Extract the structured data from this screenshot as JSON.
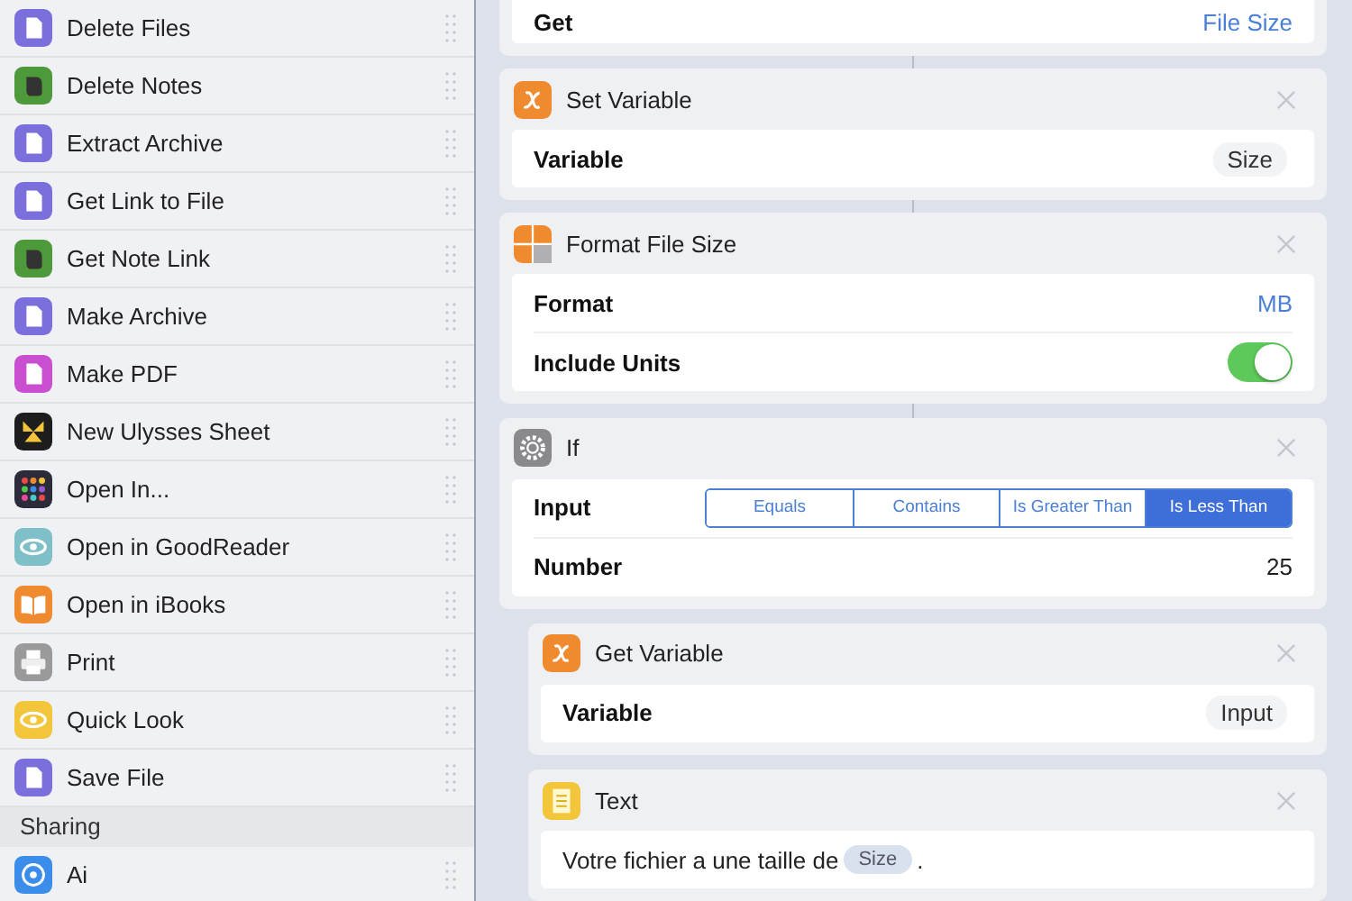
{
  "sidebar": {
    "items": [
      {
        "label": "Delete Files",
        "kind": "file"
      },
      {
        "label": "Delete Notes",
        "kind": "evernote"
      },
      {
        "label": "Extract Archive",
        "kind": "file"
      },
      {
        "label": "Get Link to File",
        "kind": "file"
      },
      {
        "label": "Get Note Link",
        "kind": "evernote"
      },
      {
        "label": "Make Archive",
        "kind": "file"
      },
      {
        "label": "Make PDF",
        "kind": "pdf"
      },
      {
        "label": "New Ulysses Sheet",
        "kind": "ulysses"
      },
      {
        "label": "Open In...",
        "kind": "apps"
      },
      {
        "label": "Open in GoodReader",
        "kind": "goodreader"
      },
      {
        "label": "Open in iBooks",
        "kind": "ibooks"
      },
      {
        "label": "Print",
        "kind": "print"
      },
      {
        "label": "Quick Look",
        "kind": "quicklook"
      },
      {
        "label": "Save File",
        "kind": "file"
      }
    ],
    "section": {
      "title": "Sharing",
      "items": [
        {
          "label": "Ai",
          "kind": "airdrop"
        }
      ]
    }
  },
  "workflow": [
    {
      "rows": [
        {
          "kind": "link",
          "label": "Get",
          "value": "File Size"
        }
      ]
    },
    {
      "title": "Set Variable",
      "kind": "variable",
      "rows": [
        {
          "kind": "token",
          "label": "Variable",
          "value": "Size"
        }
      ]
    },
    {
      "title": "Format File Size",
      "kind": "calculator",
      "rows": [
        {
          "kind": "link",
          "label": "Format",
          "value": "MB"
        },
        {
          "kind": "toggle",
          "label": "Include Units",
          "on": true
        }
      ]
    },
    {
      "title": "If",
      "kind": "gear",
      "rows": [
        {
          "kind": "segmented",
          "label": "Input",
          "options": [
            {
              "label": "Equals",
              "selected": false
            },
            {
              "label": "Contains",
              "selected": false
            },
            {
              "label": "Is Greater Than",
              "selected": false
            },
            {
              "label": "Is Less Than",
              "selected": true
            }
          ]
        },
        {
          "kind": "plain",
          "label": "Number",
          "value": "25"
        }
      ],
      "children": [
        {
          "title": "Get Variable",
          "kind": "variable",
          "rows": [
            {
              "kind": "token",
              "label": "Variable",
              "value": "Input"
            }
          ]
        },
        {
          "title": "Text",
          "kind": "text",
          "rows": [
            {
              "kind": "text",
              "before": "Votre fichier a une taille de",
              "token": "Size",
              "after": "."
            }
          ]
        }
      ]
    }
  ]
}
